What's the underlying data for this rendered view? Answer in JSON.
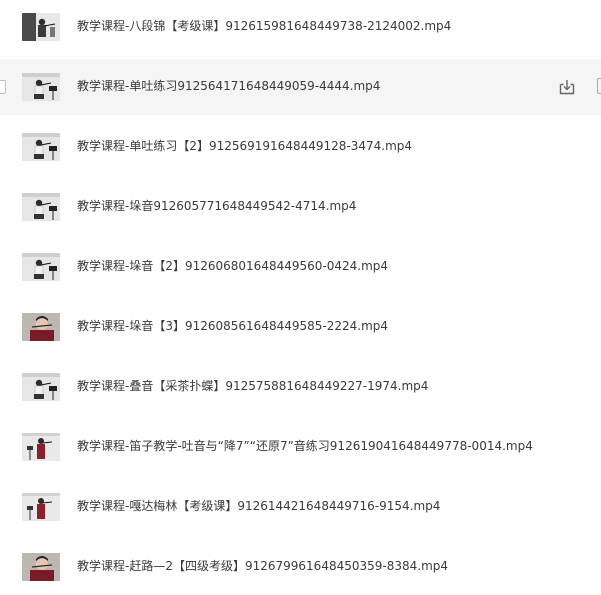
{
  "files": [
    {
      "name": "教学课程-八段锦【考级课】912615981648449738-2124002.mp4",
      "thumb": "standing-dark-bg",
      "hover": false
    },
    {
      "name": "教学课程-单吐练习912564171648449059-4444.mp4",
      "thumb": "seated-stand",
      "hover": true
    },
    {
      "name": "教学课程-单吐练习【2】912569191648449128-3474.mp4",
      "thumb": "seated-stand",
      "hover": false
    },
    {
      "name": "教学课程-垛音912605771648449542-4714.mp4",
      "thumb": "seated-stand",
      "hover": false
    },
    {
      "name": "教学课程-垛音【2】912606801648449560-0424.mp4",
      "thumb": "seated-stand",
      "hover": false
    },
    {
      "name": "教学课程-垛音【3】912608561648449585-2224.mp4",
      "thumb": "closeup-red",
      "hover": false
    },
    {
      "name": "教学课程-叠音【采茶扑蝶】912575881648449227-1974.mp4",
      "thumb": "seated-stand",
      "hover": false
    },
    {
      "name": "教学课程-笛子教学-吐音与“降7”“还原7”音练习912619041648449778-0014.mp4",
      "thumb": "standing-red",
      "hover": false
    },
    {
      "name": "教学课程-嘎达梅林【考级课】912614421648449716-9154.mp4",
      "thumb": "standing-red",
      "hover": false
    },
    {
      "name": "教学课程-赶路—2【四级考级】912679961648450359-8384.mp4",
      "thumb": "closeup-red",
      "hover": false
    }
  ],
  "icons": {
    "download": "download-icon",
    "more": "more-icon"
  },
  "colors": {
    "hover_bg": "#f5f5f6",
    "text": "#3a3a3a"
  }
}
